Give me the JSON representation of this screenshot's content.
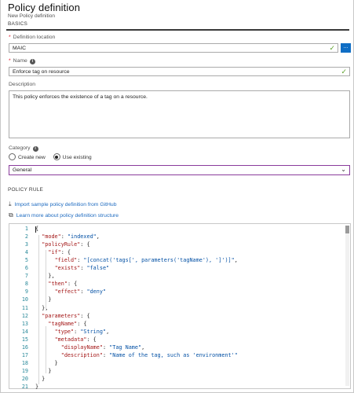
{
  "header": {
    "title": "Policy definition",
    "subtitle": "New Policy definition"
  },
  "basics": {
    "section_label": "BASICS",
    "definition_location": {
      "label": "Definition location",
      "value": "MAIC",
      "browse_label": "..."
    },
    "name": {
      "label": "Name",
      "value": "Enforce tag on resource"
    },
    "description": {
      "label": "Description",
      "value": "This policy enforces the existence of a tag on a resource."
    },
    "category": {
      "label": "Category",
      "options": [
        "Create new",
        "Use existing"
      ],
      "selected": "Use existing",
      "value": "General"
    }
  },
  "policy_rule": {
    "section_label": "POLICY RULE",
    "import_link": "Import sample policy definition from GitHub",
    "learn_link": "Learn more about policy definition structure",
    "code_lines": [
      "{",
      "  \"mode\": \"indexed\",",
      "  \"policyRule\": {",
      "    \"if\": {",
      "      \"field\": \"[concat('tags[', parameters('tagName'), ']')]\",",
      "      \"exists\": \"false\"",
      "    },",
      "    \"then\": {",
      "      \"effect\": \"deny\"",
      "    }",
      "  },",
      "  \"parameters\": {",
      "    \"tagName\": {",
      "      \"type\": \"String\",",
      "      \"metadata\": {",
      "        \"displayName\": \"Tag Name\",",
      "        \"description\": \"Name of the tag, such as 'environment'\"",
      "      }",
      "    }",
      "  }",
      "}"
    ],
    "line_numbers": [
      "1",
      "2",
      "3",
      "4",
      "5",
      "6",
      "7",
      "8",
      "9",
      "10",
      "11",
      "12",
      "13",
      "14",
      "15",
      "16",
      "17",
      "18",
      "19",
      "20",
      "21"
    ]
  },
  "colors": {
    "accent": "#0f6ec5",
    "check": "#5ca12b",
    "required": "#e00b1c",
    "select_border": "#8a3c9c"
  },
  "icons": [
    "check-icon",
    "info-icon",
    "chevron-down-icon",
    "download-icon",
    "external-link-icon"
  ]
}
